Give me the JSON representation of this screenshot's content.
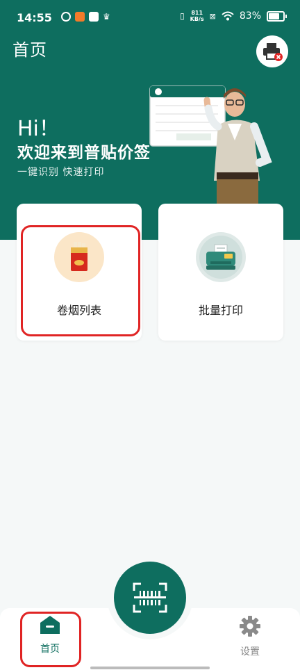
{
  "status_bar": {
    "time": "14:55",
    "net_speed_value": "811",
    "net_speed_unit": "KB/s",
    "battery": "83%"
  },
  "header": {
    "title": "首页"
  },
  "hero": {
    "greeting": "Hi！",
    "welcome": "欢迎来到普贴价签",
    "subtitle": "一键识别 快速打印"
  },
  "cards": [
    {
      "label": "卷烟列表",
      "icon": "cigarette-pack-icon"
    },
    {
      "label": "批量打印",
      "icon": "printer-icon"
    }
  ],
  "nav": {
    "home_label": "首页",
    "settings_label": "设置"
  },
  "colors": {
    "brand": "#0e6e5f",
    "highlight": "#e02424"
  }
}
